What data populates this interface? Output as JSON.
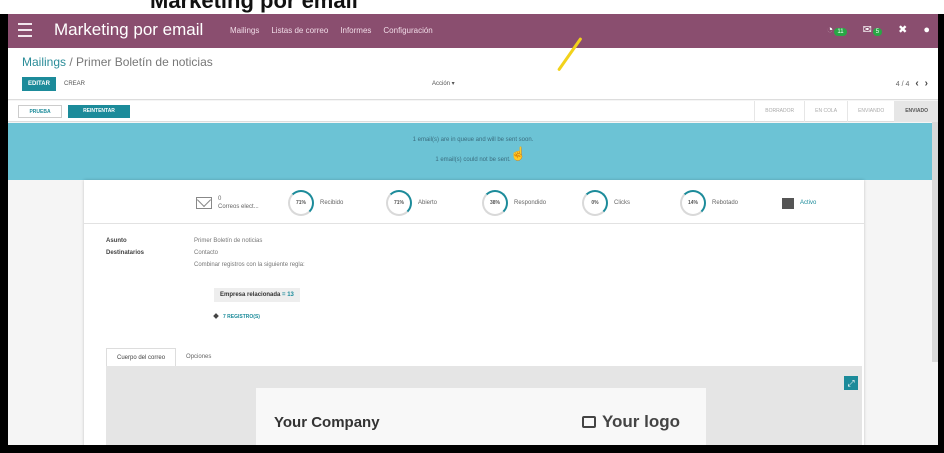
{
  "caption": "Marketing por email",
  "navbar": {
    "brand": "Marketing por email",
    "menu": [
      "Mailings",
      "Listas de correo",
      "Informes",
      "Configuración"
    ],
    "badges": [
      "11",
      "5"
    ]
  },
  "control": {
    "breadcrumb_root": "Mailings",
    "breadcrumb_sep": " / ",
    "breadcrumb_current": "Primer Boletín de noticias",
    "edit_label": "EDITAR",
    "create_label": "CREAR",
    "action_label": "Acción ▾",
    "pager": "4 / 4"
  },
  "statusbar": {
    "test_label": "PRUEBA",
    "retry_label": "REINTENTAR",
    "stages": [
      "BORRADOR",
      "EN COLA",
      "ENVIANDO",
      "ENVIADO"
    ]
  },
  "alert": {
    "line1": "1 email(s) are in queue and will be sent soon.",
    "line2": "1 email(s) could not be sent."
  },
  "stats": {
    "emails_count": "0",
    "emails_label": "Correos elect...",
    "items": [
      {
        "pct": "71%",
        "label": "Recibido"
      },
      {
        "pct": "71%",
        "label": "Abierto"
      },
      {
        "pct": "38%",
        "label": "Respondido"
      },
      {
        "pct": "0%",
        "label": "Clicks"
      },
      {
        "pct": "14%",
        "label": "Rebotado"
      }
    ],
    "active_label": "Activo"
  },
  "fields": {
    "subject_label": "Asunto",
    "subject_value": "Primer Boletín de noticias",
    "recipients_label": "Destinatarios",
    "recipients_value": "Contacto",
    "rule_text": "Combinar registros con la siguiente regla:",
    "tag_label": "Empresa relacionada",
    "tag_value": " = 13",
    "records_label": "7 REGISTRO(S)"
  },
  "tabs": [
    "Cuerpo del correo",
    "Opciones"
  ],
  "mail": {
    "company": "Your Company",
    "logo": "Your logo"
  },
  "colors": {
    "navbar": "#8a4e6f",
    "primary": "#1c8b9a",
    "alert": "#6cc3d5"
  }
}
